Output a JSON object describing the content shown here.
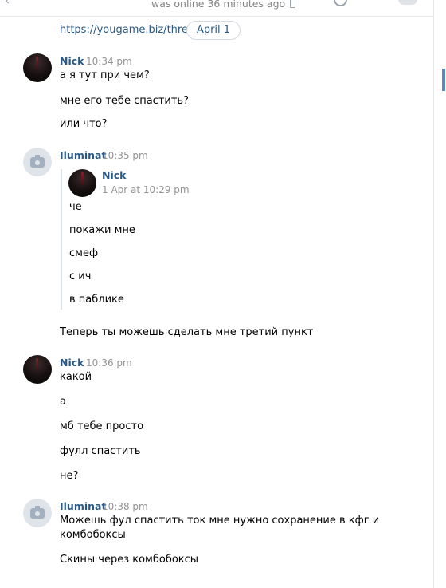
{
  "header": {
    "status": "was online 36 minutes ago"
  },
  "link_text": "https://yougame.biz/thread",
  "date_pill": "April 1",
  "messages": [
    {
      "author": "Nick",
      "time": "10:34 pm",
      "avatar": "nick-avatar-photo",
      "lines": [
        "а я тут при чем?",
        "мне его тебе спастить?",
        "или что?"
      ]
    },
    {
      "author": "Iluminat",
      "time": "10:35 pm",
      "avatar": "camera-icon",
      "forwarded": {
        "author": "Nick",
        "time": "1 Apr at 10:29 pm",
        "lines": [
          "че",
          "покажи мне",
          "смеф",
          "с ич",
          "в паблике"
        ]
      },
      "lines": [
        "Теперь ты можешь сделать мне третий пункт"
      ]
    },
    {
      "author": "Nick",
      "time": "10:36 pm",
      "avatar": "nick-avatar-photo",
      "lines": [
        "какой",
        "а",
        "мб тебе просто",
        "фулл спастить",
        "не?"
      ]
    },
    {
      "author": "Iluminat",
      "time": "10:38 pm",
      "avatar": "camera-icon",
      "lines": [
        "Можешь фул спастить ток мне нужно сохранение в кфг и",
        "комбобоксы",
        "Скины через комбобоксы"
      ]
    }
  ],
  "colors": {
    "author": "#2a5885",
    "time": "#939393",
    "link": "#2a5885",
    "border": "#e7e8ec"
  }
}
